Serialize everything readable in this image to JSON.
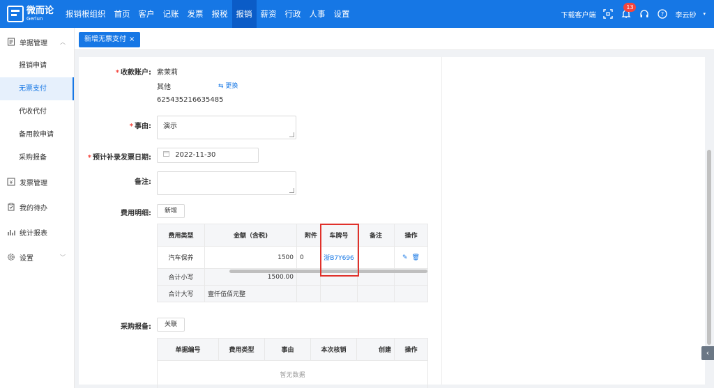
{
  "brand": {
    "name_cn": "微而论",
    "name_en": "Gerlun"
  },
  "nav": [
    "报销根组织",
    "首页",
    "客户",
    "记账",
    "发票",
    "报税",
    "报销",
    "薪资",
    "行政",
    "人事",
    "设置"
  ],
  "top_right": {
    "download": "下载客户端",
    "badge_count": "13",
    "user": "李云砂"
  },
  "sidebar": {
    "group1": "单据管理",
    "items": [
      "报销申请",
      "无票支付",
      "代收代付",
      "备用款申请",
      "采购报备"
    ],
    "group2": "发票管理",
    "group3": "我的待办",
    "group4": "统计报表",
    "group5": "设置"
  },
  "tab": {
    "label": "新增无票支付",
    "close": "×"
  },
  "form": {
    "account_label": "收款账户:",
    "account_name": "紫茉莉",
    "account_type": "其他",
    "change_link": "更换",
    "account_number": "625435216635485",
    "reason_label": "事由:",
    "reason_value": "演示",
    "date_label": "预计补录发票日期:",
    "date_value": "2022-11-30",
    "note_label": "备注:",
    "detail_label": "费用明细:",
    "add_button": "新增",
    "purchase_label": "采购报备:",
    "link_button": "关联"
  },
  "detail_table": {
    "headers": [
      "费用类型",
      "金额（含税)",
      "附件",
      "车牌号",
      "备注",
      "操作"
    ],
    "row": {
      "type": "汽车保养",
      "amount": "1500",
      "attach": "0",
      "plate": "浙B7Y696"
    },
    "subtotal_label": "合计小写",
    "subtotal_value": "1500.00",
    "total_label": "合计大写",
    "total_value": "壹仟伍佰元整"
  },
  "purchase_table": {
    "headers": [
      "单据编号",
      "费用类型",
      "事由",
      "本次核销",
      "创建",
      "操作"
    ],
    "empty": "暂无数据"
  },
  "colors": {
    "primary": "#1677e5",
    "highlight": "#e0312b"
  }
}
